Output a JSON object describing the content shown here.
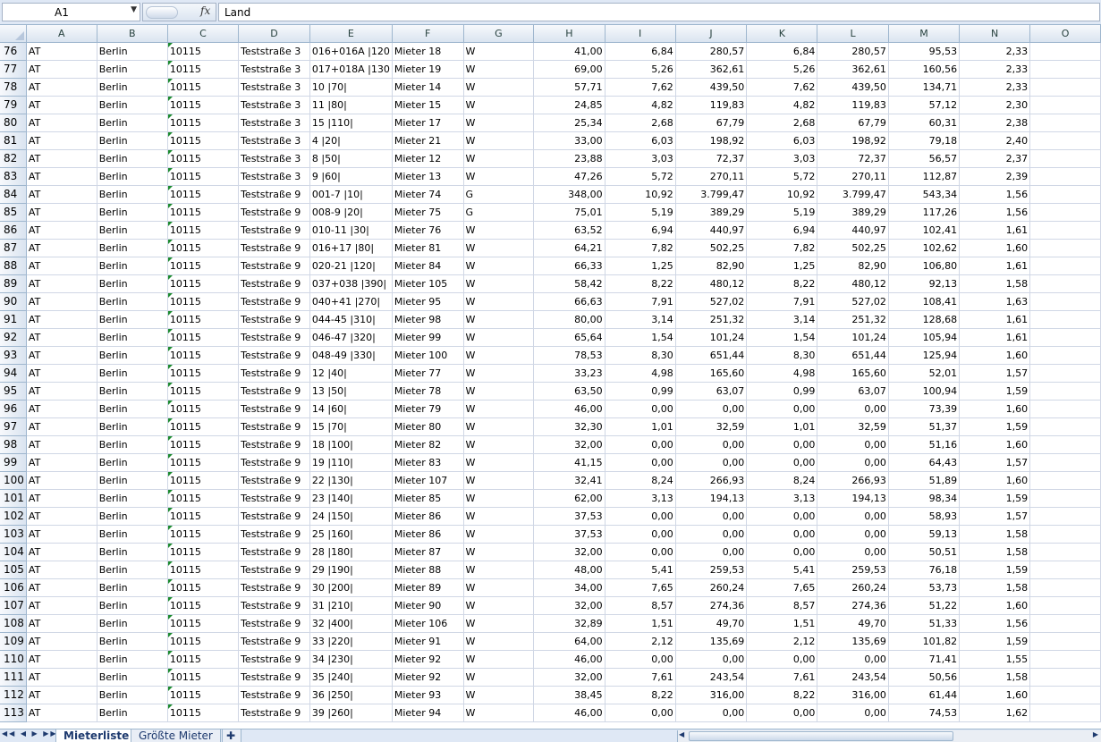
{
  "formula_bar": {
    "name_box": "A1",
    "fx_label": "fx",
    "formula": "Land"
  },
  "columns": [
    "A",
    "B",
    "C",
    "D",
    "E",
    "F",
    "G",
    "H",
    "I",
    "J",
    "K",
    "L",
    "M",
    "N",
    "O"
  ],
  "rows": [
    {
      "row": "76",
      "cells": [
        "AT",
        "Berlin",
        "10115",
        "Teststraße 3",
        "016+016A |120",
        "Mieter 18",
        "W",
        "41,00",
        "6,84",
        "280,57",
        "6,84",
        "280,57",
        "95,53",
        "2,33",
        ""
      ]
    },
    {
      "row": "77",
      "cells": [
        "AT",
        "Berlin",
        "10115",
        "Teststraße 3",
        "017+018A |130",
        "Mieter 19",
        "W",
        "69,00",
        "5,26",
        "362,61",
        "5,26",
        "362,61",
        "160,56",
        "2,33",
        ""
      ]
    },
    {
      "row": "78",
      "cells": [
        "AT",
        "Berlin",
        "10115",
        "Teststraße 3",
        "10 |70|",
        "Mieter 14",
        "W",
        "57,71",
        "7,62",
        "439,50",
        "7,62",
        "439,50",
        "134,71",
        "2,33",
        ""
      ]
    },
    {
      "row": "79",
      "cells": [
        "AT",
        "Berlin",
        "10115",
        "Teststraße 3",
        "11 |80|",
        "Mieter 15",
        "W",
        "24,85",
        "4,82",
        "119,83",
        "4,82",
        "119,83",
        "57,12",
        "2,30",
        ""
      ]
    },
    {
      "row": "80",
      "cells": [
        "AT",
        "Berlin",
        "10115",
        "Teststraße 3",
        "15 |110|",
        "Mieter 17",
        "W",
        "25,34",
        "2,68",
        "67,79",
        "2,68",
        "67,79",
        "60,31",
        "2,38",
        ""
      ]
    },
    {
      "row": "81",
      "cells": [
        "AT",
        "Berlin",
        "10115",
        "Teststraße 3",
        "4 |20|",
        "Mieter 21",
        "W",
        "33,00",
        "6,03",
        "198,92",
        "6,03",
        "198,92",
        "79,18",
        "2,40",
        ""
      ]
    },
    {
      "row": "82",
      "cells": [
        "AT",
        "Berlin",
        "10115",
        "Teststraße 3",
        "8 |50|",
        "Mieter 12",
        "W",
        "23,88",
        "3,03",
        "72,37",
        "3,03",
        "72,37",
        "56,57",
        "2,37",
        ""
      ]
    },
    {
      "row": "83",
      "cells": [
        "AT",
        "Berlin",
        "10115",
        "Teststraße 3",
        "9 |60|",
        "Mieter 13",
        "W",
        "47,26",
        "5,72",
        "270,11",
        "5,72",
        "270,11",
        "112,87",
        "2,39",
        ""
      ]
    },
    {
      "row": "84",
      "cells": [
        "AT",
        "Berlin",
        "10115",
        "Teststraße 9",
        "001-7 |10|",
        "Mieter 74",
        "G",
        "348,00",
        "10,92",
        "3.799,47",
        "10,92",
        "3.799,47",
        "543,34",
        "1,56",
        ""
      ]
    },
    {
      "row": "85",
      "cells": [
        "AT",
        "Berlin",
        "10115",
        "Teststraße 9",
        "008-9 |20|",
        "Mieter 75",
        "G",
        "75,01",
        "5,19",
        "389,29",
        "5,19",
        "389,29",
        "117,26",
        "1,56",
        ""
      ]
    },
    {
      "row": "86",
      "cells": [
        "AT",
        "Berlin",
        "10115",
        "Teststraße 9",
        "010-11 |30|",
        "Mieter 76",
        "W",
        "63,52",
        "6,94",
        "440,97",
        "6,94",
        "440,97",
        "102,41",
        "1,61",
        ""
      ]
    },
    {
      "row": "87",
      "cells": [
        "AT",
        "Berlin",
        "10115",
        "Teststraße 9",
        "016+17 |80|",
        "Mieter 81",
        "W",
        "64,21",
        "7,82",
        "502,25",
        "7,82",
        "502,25",
        "102,62",
        "1,60",
        ""
      ]
    },
    {
      "row": "88",
      "cells": [
        "AT",
        "Berlin",
        "10115",
        "Teststraße 9",
        "020-21 |120|",
        "Mieter 84",
        "W",
        "66,33",
        "1,25",
        "82,90",
        "1,25",
        "82,90",
        "106,80",
        "1,61",
        ""
      ]
    },
    {
      "row": "89",
      "cells": [
        "AT",
        "Berlin",
        "10115",
        "Teststraße 9",
        "037+038 |390|",
        "Mieter 105",
        "W",
        "58,42",
        "8,22",
        "480,12",
        "8,22",
        "480,12",
        "92,13",
        "1,58",
        ""
      ]
    },
    {
      "row": "90",
      "cells": [
        "AT",
        "Berlin",
        "10115",
        "Teststraße 9",
        "040+41 |270|",
        "Mieter 95",
        "W",
        "66,63",
        "7,91",
        "527,02",
        "7,91",
        "527,02",
        "108,41",
        "1,63",
        ""
      ]
    },
    {
      "row": "91",
      "cells": [
        "AT",
        "Berlin",
        "10115",
        "Teststraße 9",
        "044-45 |310|",
        "Mieter 98",
        "W",
        "80,00",
        "3,14",
        "251,32",
        "3,14",
        "251,32",
        "128,68",
        "1,61",
        ""
      ]
    },
    {
      "row": "92",
      "cells": [
        "AT",
        "Berlin",
        "10115",
        "Teststraße 9",
        "046-47 |320|",
        "Mieter 99",
        "W",
        "65,64",
        "1,54",
        "101,24",
        "1,54",
        "101,24",
        "105,94",
        "1,61",
        ""
      ]
    },
    {
      "row": "93",
      "cells": [
        "AT",
        "Berlin",
        "10115",
        "Teststraße 9",
        "048-49 |330|",
        "Mieter 100",
        "W",
        "78,53",
        "8,30",
        "651,44",
        "8,30",
        "651,44",
        "125,94",
        "1,60",
        ""
      ]
    },
    {
      "row": "94",
      "cells": [
        "AT",
        "Berlin",
        "10115",
        "Teststraße 9",
        "12 |40|",
        "Mieter 77",
        "W",
        "33,23",
        "4,98",
        "165,60",
        "4,98",
        "165,60",
        "52,01",
        "1,57",
        ""
      ]
    },
    {
      "row": "95",
      "cells": [
        "AT",
        "Berlin",
        "10115",
        "Teststraße 9",
        "13 |50|",
        "Mieter 78",
        "W",
        "63,50",
        "0,99",
        "63,07",
        "0,99",
        "63,07",
        "100,94",
        "1,59",
        ""
      ]
    },
    {
      "row": "96",
      "cells": [
        "AT",
        "Berlin",
        "10115",
        "Teststraße 9",
        "14 |60|",
        "Mieter 79",
        "W",
        "46,00",
        "0,00",
        "0,00",
        "0,00",
        "0,00",
        "73,39",
        "1,60",
        ""
      ]
    },
    {
      "row": "97",
      "cells": [
        "AT",
        "Berlin",
        "10115",
        "Teststraße 9",
        "15 |70|",
        "Mieter 80",
        "W",
        "32,30",
        "1,01",
        "32,59",
        "1,01",
        "32,59",
        "51,37",
        "1,59",
        ""
      ]
    },
    {
      "row": "98",
      "cells": [
        "AT",
        "Berlin",
        "10115",
        "Teststraße 9",
        "18 |100|",
        "Mieter 82",
        "W",
        "32,00",
        "0,00",
        "0,00",
        "0,00",
        "0,00",
        "51,16",
        "1,60",
        ""
      ]
    },
    {
      "row": "99",
      "cells": [
        "AT",
        "Berlin",
        "10115",
        "Teststraße 9",
        "19 |110|",
        "Mieter 83",
        "W",
        "41,15",
        "0,00",
        "0,00",
        "0,00",
        "0,00",
        "64,43",
        "1,57",
        ""
      ]
    },
    {
      "row": "100",
      "cells": [
        "AT",
        "Berlin",
        "10115",
        "Teststraße 9",
        "22 |130|",
        "Mieter 107",
        "W",
        "32,41",
        "8,24",
        "266,93",
        "8,24",
        "266,93",
        "51,89",
        "1,60",
        ""
      ]
    },
    {
      "row": "101",
      "cells": [
        "AT",
        "Berlin",
        "10115",
        "Teststraße 9",
        "23 |140|",
        "Mieter 85",
        "W",
        "62,00",
        "3,13",
        "194,13",
        "3,13",
        "194,13",
        "98,34",
        "1,59",
        ""
      ]
    },
    {
      "row": "102",
      "cells": [
        "AT",
        "Berlin",
        "10115",
        "Teststraße 9",
        "24 |150|",
        "Mieter 86",
        "W",
        "37,53",
        "0,00",
        "0,00",
        "0,00",
        "0,00",
        "58,93",
        "1,57",
        ""
      ]
    },
    {
      "row": "103",
      "cells": [
        "AT",
        "Berlin",
        "10115",
        "Teststraße 9",
        "25 |160|",
        "Mieter 86",
        "W",
        "37,53",
        "0,00",
        "0,00",
        "0,00",
        "0,00",
        "59,13",
        "1,58",
        ""
      ]
    },
    {
      "row": "104",
      "cells": [
        "AT",
        "Berlin",
        "10115",
        "Teststraße 9",
        "28 |180|",
        "Mieter 87",
        "W",
        "32,00",
        "0,00",
        "0,00",
        "0,00",
        "0,00",
        "50,51",
        "1,58",
        ""
      ]
    },
    {
      "row": "105",
      "cells": [
        "AT",
        "Berlin",
        "10115",
        "Teststraße 9",
        "29 |190|",
        "Mieter 88",
        "W",
        "48,00",
        "5,41",
        "259,53",
        "5,41",
        "259,53",
        "76,18",
        "1,59",
        ""
      ]
    },
    {
      "row": "106",
      "cells": [
        "AT",
        "Berlin",
        "10115",
        "Teststraße 9",
        "30 |200|",
        "Mieter 89",
        "W",
        "34,00",
        "7,65",
        "260,24",
        "7,65",
        "260,24",
        "53,73",
        "1,58",
        ""
      ]
    },
    {
      "row": "107",
      "cells": [
        "AT",
        "Berlin",
        "10115",
        "Teststraße 9",
        "31 |210|",
        "Mieter 90",
        "W",
        "32,00",
        "8,57",
        "274,36",
        "8,57",
        "274,36",
        "51,22",
        "1,60",
        ""
      ]
    },
    {
      "row": "108",
      "cells": [
        "AT",
        "Berlin",
        "10115",
        "Teststraße 9",
        "32 |400|",
        "Mieter 106",
        "W",
        "32,89",
        "1,51",
        "49,70",
        "1,51",
        "49,70",
        "51,33",
        "1,56",
        ""
      ]
    },
    {
      "row": "109",
      "cells": [
        "AT",
        "Berlin",
        "10115",
        "Teststraße 9",
        "33 |220|",
        "Mieter 91",
        "W",
        "64,00",
        "2,12",
        "135,69",
        "2,12",
        "135,69",
        "101,82",
        "1,59",
        ""
      ]
    },
    {
      "row": "110",
      "cells": [
        "AT",
        "Berlin",
        "10115",
        "Teststraße 9",
        "34 |230|",
        "Mieter 92",
        "W",
        "46,00",
        "0,00",
        "0,00",
        "0,00",
        "0,00",
        "71,41",
        "1,55",
        ""
      ]
    },
    {
      "row": "111",
      "cells": [
        "AT",
        "Berlin",
        "10115",
        "Teststraße 9",
        "35 |240|",
        "Mieter 92",
        "W",
        "32,00",
        "7,61",
        "243,54",
        "7,61",
        "243,54",
        "50,56",
        "1,58",
        ""
      ]
    },
    {
      "row": "112",
      "cells": [
        "AT",
        "Berlin",
        "10115",
        "Teststraße 9",
        "36 |250|",
        "Mieter 93",
        "W",
        "38,45",
        "8,22",
        "316,00",
        "8,22",
        "316,00",
        "61,44",
        "1,60",
        ""
      ]
    },
    {
      "row": "113",
      "cells": [
        "AT",
        "Berlin",
        "10115",
        "Teststraße 9",
        "39 |260|",
        "Mieter 94",
        "W",
        "46,00",
        "0,00",
        "0,00",
        "0,00",
        "0,00",
        "74,53",
        "1,62",
        ""
      ]
    }
  ],
  "sheet_tabs": [
    "Mieterliste",
    "Größte Mieter"
  ],
  "icons": {
    "nav_arrows": "◀◀ ◀ ▶ ▶▶",
    "insert_sheet": "insert-sheet-icon"
  }
}
